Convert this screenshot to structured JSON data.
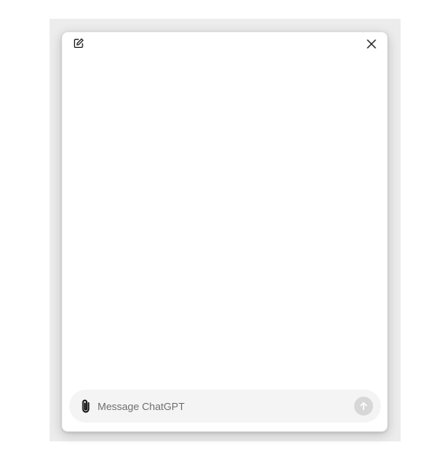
{
  "window": {
    "header": {
      "new_chat_icon": "edit-icon",
      "close_icon": "close-icon"
    },
    "composer": {
      "attach_icon": "paperclip-icon",
      "input_value": "",
      "placeholder": "Message ChatGPT",
      "send_icon": "arrow-up-icon",
      "send_enabled": false
    }
  },
  "colors": {
    "composer_background": "#f4f4f4",
    "send_button_disabled": "#d7d7d7",
    "placeholder_text": "#6f6f6f"
  }
}
